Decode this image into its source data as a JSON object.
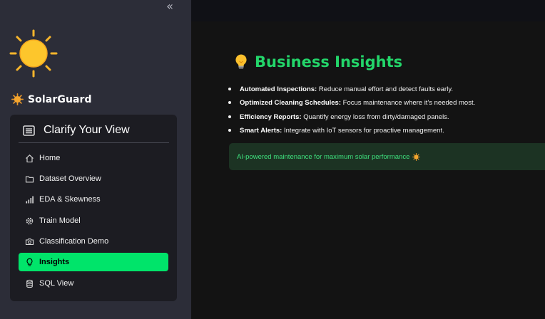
{
  "sidebar": {
    "collapse_glyph": "«",
    "brand": {
      "name": "SolarGuard",
      "icon": "sun-icon"
    },
    "nav": {
      "header": "Clarify Your View",
      "header_icon": "list-icon",
      "items": [
        {
          "label": "Home",
          "icon": "home-icon",
          "active": false
        },
        {
          "label": "Dataset Overview",
          "icon": "folder-icon",
          "active": false
        },
        {
          "label": "EDA & Skewness",
          "icon": "bar-chart-icon",
          "active": false
        },
        {
          "label": "Train Model",
          "icon": "gear-icon",
          "active": false
        },
        {
          "label": "Classification Demo",
          "icon": "camera-icon",
          "active": false
        },
        {
          "label": "Insights",
          "icon": "lightbulb-icon",
          "active": true
        },
        {
          "label": "SQL View",
          "icon": "database-icon",
          "active": false
        }
      ]
    }
  },
  "main": {
    "title": "Business Insights",
    "title_icon": "lightbulb-icon",
    "bullets": [
      {
        "bold": "Automated Inspections:",
        "text": " Reduce manual effort and detect faults early."
      },
      {
        "bold": "Optimized Cleaning Schedules:",
        "text": " Focus maintenance where it's needed most."
      },
      {
        "bold": "Efficiency Reports:",
        "text": " Quantify energy loss from dirty/damaged panels."
      },
      {
        "bold": "Smart Alerts:",
        "text": " Integrate with IoT sensors for proactive management."
      }
    ],
    "success_message": "AI-powered maintenance for maximum solar performance"
  },
  "colors": {
    "accent": "#00e46a",
    "title": "#23d66a",
    "sidebar_bg": "#2c2d38",
    "panel_bg": "#1c1c22",
    "main_bg": "#131313",
    "success_bg": "#1c3323",
    "success_text": "#3ee07d"
  }
}
